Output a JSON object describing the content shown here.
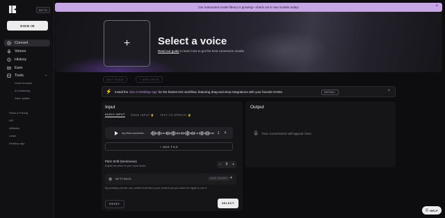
{
  "sidebar": {
    "beta": "BETA",
    "signin": "SIGN IN",
    "nav": [
      {
        "label": "Convert",
        "icon": "convert-icon"
      },
      {
        "label": "Voices",
        "icon": "voices-icon"
      },
      {
        "label": "History",
        "icon": "history-icon"
      },
      {
        "label": "Earn",
        "icon": "earn-icon"
      },
      {
        "label": "Tools",
        "icon": "tools-icon"
      }
    ],
    "tools": [
      "Vocal remover",
      "AI mastering",
      "Stem splitter"
    ],
    "links": [
      "Plans & Pricing",
      "API",
      "Affiliates",
      "Learn",
      "Desktop app"
    ]
  },
  "banner": {
    "text": "Our instrument model library is growing—check out 5 new models today!"
  },
  "hero": {
    "title": "Select a voice",
    "guide_link": "Read our guide",
    "guide_rest": " to learn how to get the best conversion results"
  },
  "toolbar": {
    "edit_voice": "EDIT VOICE",
    "add_voice": "ADD VOICE"
  },
  "app_banner": {
    "pre": "Install the",
    "highlight": "Kits AI Desktop App",
    "post": "for the fastest Kits workflow, featuring drag-and-drop integrations with your favorite DAWs.",
    "install": "INSTALL"
  },
  "input": {
    "title": "Input",
    "tabs": [
      "AUDIO INPUT",
      "SONG INPUT",
      "TEXT-TO-SPEECH"
    ],
    "file_name": "my-first-conversio...",
    "add_file": "+ ADD FILE",
    "pitch_label": "Pitch Shift (Semitones)",
    "pitch_desc": "Adjust the pitch of your input audio.",
    "pitch_value": "0",
    "settings": "SETTINGS",
    "preset": "SAVE PRESET",
    "consent": "By pressing convert, you confirm that this is your content and you have the rights to use it.",
    "reset": "RESET",
    "select": "SELECT"
  },
  "output": {
    "title": "Output",
    "placeholder": "Your conversions will appear here"
  },
  "help": "HELP"
}
